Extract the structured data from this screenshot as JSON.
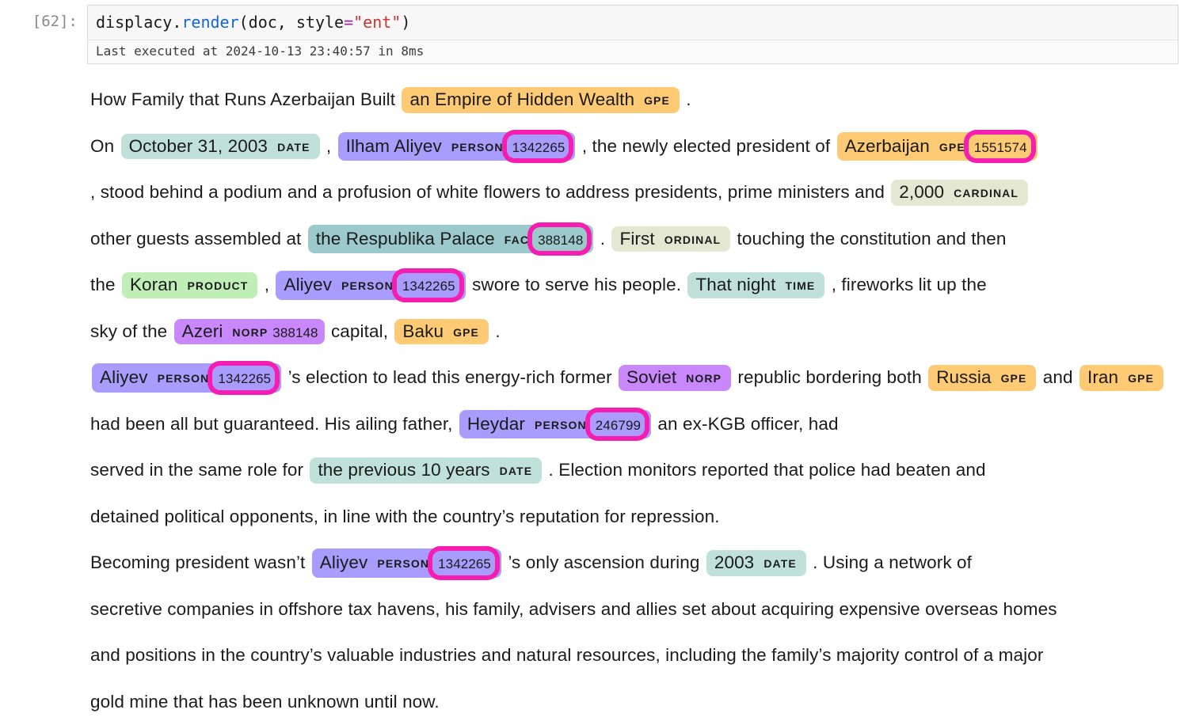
{
  "notebook": {
    "prompt": "[62]:",
    "code": {
      "obj": "displacy.",
      "fn": "render",
      "args_open": "(doc, style",
      "op": "=",
      "str": "\"ent\"",
      "close": ")"
    },
    "exec_status": "Last executed at 2024-10-13 23:40:57 in 8ms"
  },
  "colors": {
    "gpe": "#feca74",
    "date": "#bfe1d9",
    "person": "#aa9cfc",
    "cardinal": "#e4e7d2",
    "ordinal": "#e4e7d2",
    "fac": "#9cc9cc",
    "product": "#bfeeb7",
    "time": "#bfe1d9",
    "norp": "#c887fb",
    "highlight": "#f51eb0",
    "code_function": "#1565d8",
    "code_string": "#cc3333",
    "code_operator": "#a626a4"
  },
  "render": {
    "segments": [
      {
        "kind": "text",
        "value": "How Family that Runs Azerbaijan Built "
      },
      {
        "kind": "ent",
        "text": "an Empire of Hidden Wealth",
        "label": "GPE",
        "kb": "",
        "color": "gpe",
        "highlighted": false
      },
      {
        "kind": "text",
        "value": " ."
      },
      {
        "kind": "break"
      },
      {
        "kind": "text",
        "value": "On "
      },
      {
        "kind": "ent",
        "text": "October 31, 2003",
        "label": "DATE",
        "kb": "",
        "color": "date",
        "highlighted": false
      },
      {
        "kind": "text",
        "value": " , "
      },
      {
        "kind": "ent",
        "text": "Ilham Aliyev",
        "label": "PERSON",
        "kb": "1342265",
        "color": "person",
        "highlighted": true
      },
      {
        "kind": "text",
        "value": " , the newly elected president of "
      },
      {
        "kind": "ent",
        "text": "Azerbaijan",
        "label": "GPE",
        "kb": "1551574",
        "color": "gpe",
        "highlighted": true
      },
      {
        "kind": "break"
      },
      {
        "kind": "text",
        "value": ", stood behind a podium and a profusion of white flowers to address presidents, prime ministers and "
      },
      {
        "kind": "ent",
        "text": "2,000",
        "label": "CARDINAL",
        "kb": "",
        "color": "cardinal",
        "highlighted": false
      },
      {
        "kind": "break"
      },
      {
        "kind": "text",
        "value": "other guests assembled at "
      },
      {
        "kind": "ent",
        "text": "the Respublika Palace",
        "label": "FAC",
        "kb": "388148",
        "color": "fac",
        "highlighted": true
      },
      {
        "kind": "text",
        "value": " . "
      },
      {
        "kind": "ent",
        "text": "First",
        "label": "ORDINAL",
        "kb": "",
        "color": "ordinal",
        "highlighted": false
      },
      {
        "kind": "text",
        "value": " touching the constitution and then"
      },
      {
        "kind": "break"
      },
      {
        "kind": "text",
        "value": "the "
      },
      {
        "kind": "ent",
        "text": "Koran",
        "label": "PRODUCT",
        "kb": "",
        "color": "product",
        "highlighted": false
      },
      {
        "kind": "text",
        "value": " , "
      },
      {
        "kind": "ent",
        "text": "Aliyev",
        "label": "PERSON",
        "kb": "1342265",
        "color": "person",
        "highlighted": true
      },
      {
        "kind": "text",
        "value": " swore to serve his people. "
      },
      {
        "kind": "ent",
        "text": "That night",
        "label": "TIME",
        "kb": "",
        "color": "time",
        "highlighted": false
      },
      {
        "kind": "text",
        "value": " , fireworks lit up the"
      },
      {
        "kind": "break"
      },
      {
        "kind": "text",
        "value": "sky of the "
      },
      {
        "kind": "ent",
        "text": "Azeri",
        "label": "NORP",
        "kb": "388148",
        "color": "norp",
        "highlighted": false
      },
      {
        "kind": "text",
        "value": " capital, "
      },
      {
        "kind": "ent",
        "text": "Baku",
        "label": "GPE",
        "kb": "",
        "color": "gpe",
        "highlighted": false
      },
      {
        "kind": "text",
        "value": " ."
      },
      {
        "kind": "break"
      },
      {
        "kind": "ent",
        "text": "Aliyev",
        "label": "PERSON",
        "kb": "1342265",
        "color": "person",
        "highlighted": true
      },
      {
        "kind": "text",
        "value": " ’s election to lead this energy-rich former "
      },
      {
        "kind": "ent",
        "text": "Soviet",
        "label": "NORP",
        "kb": "",
        "color": "norp",
        "highlighted": false
      },
      {
        "kind": "text",
        "value": " republic bordering both "
      },
      {
        "kind": "ent",
        "text": "Russia",
        "label": "GPE",
        "kb": "",
        "color": "gpe",
        "highlighted": false
      },
      {
        "kind": "text",
        "value": " and "
      },
      {
        "kind": "ent",
        "text": "Iran",
        "label": "GPE",
        "kb": "",
        "color": "gpe",
        "highlighted": false
      },
      {
        "kind": "text",
        "value": " had been all but guaranteed. His ailing father, "
      },
      {
        "kind": "ent",
        "text": "Heydar",
        "label": "PERSON",
        "kb": "246799",
        "color": "person",
        "highlighted": true
      },
      {
        "kind": "text",
        "value": " an ex-KGB officer, had"
      },
      {
        "kind": "break"
      },
      {
        "kind": "text",
        "value": "served in the same role for "
      },
      {
        "kind": "ent",
        "text": "the previous 10 years",
        "label": "DATE",
        "kb": "",
        "color": "date",
        "highlighted": false
      },
      {
        "kind": "text",
        "value": " . Election monitors reported that police had beaten and"
      },
      {
        "kind": "break"
      },
      {
        "kind": "text",
        "value": "detained political opponents, in line with the country’s reputation for repression."
      },
      {
        "kind": "break"
      },
      {
        "kind": "text",
        "value": "Becoming president wasn’t "
      },
      {
        "kind": "ent",
        "text": "Aliyev",
        "label": "PERSON",
        "kb": "1342265",
        "color": "person",
        "highlighted": true
      },
      {
        "kind": "text",
        "value": " ’s only ascension during "
      },
      {
        "kind": "ent",
        "text": "2003",
        "label": "DATE",
        "kb": "",
        "color": "date",
        "highlighted": false
      },
      {
        "kind": "text",
        "value": " . Using a network of"
      },
      {
        "kind": "break"
      },
      {
        "kind": "text",
        "value": "secretive companies in offshore tax havens, his family, advisers and allies set about acquiring expensive overseas homes"
      },
      {
        "kind": "break"
      },
      {
        "kind": "text",
        "value": "and positions in the country’s valuable industries and natural resources, including the family’s majority control of a major"
      },
      {
        "kind": "break"
      },
      {
        "kind": "text",
        "value": "gold mine that has been unknown until now."
      }
    ]
  }
}
